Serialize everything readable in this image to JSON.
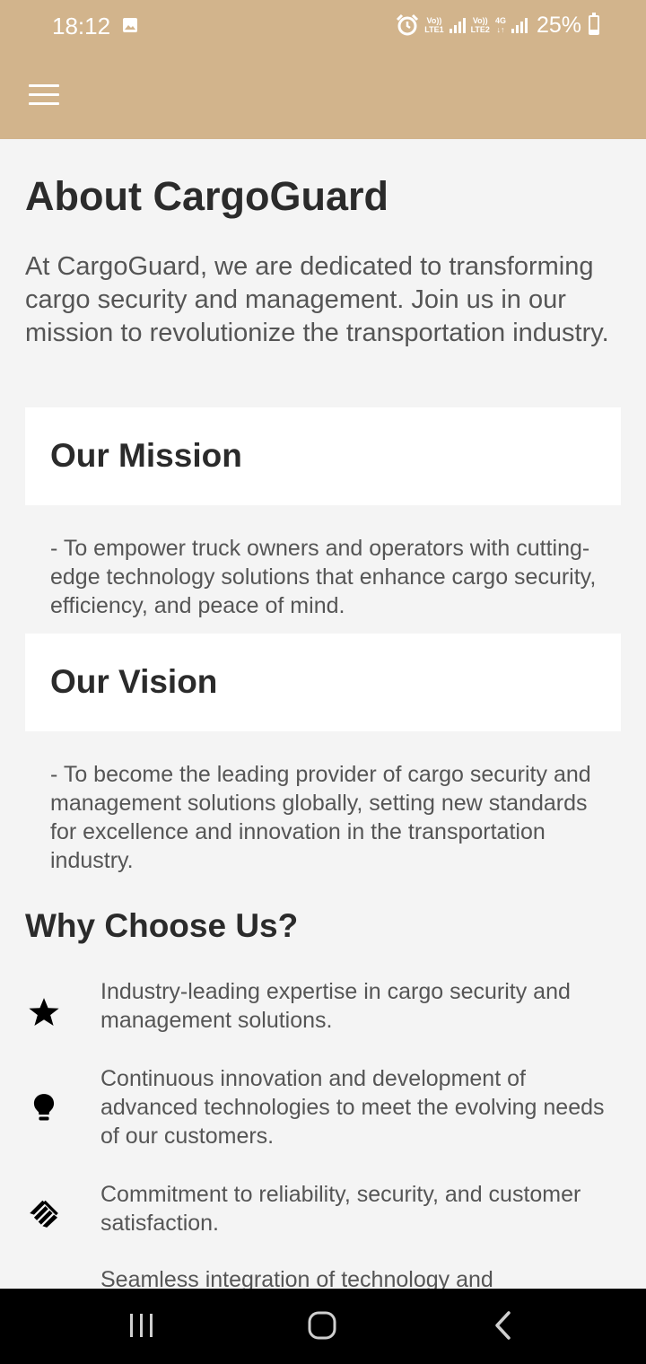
{
  "status_bar": {
    "time": "18:12",
    "sim1": {
      "top": "Vo))",
      "bottom": "LTE1"
    },
    "sim2": {
      "top": "Vo))",
      "bottom": "LTE2"
    },
    "network_type": "4G",
    "battery_percent": "25%",
    "icons": [
      "gallery-icon",
      "alarm-icon",
      "signal-icon",
      "battery-icon"
    ]
  },
  "app_bar": {
    "background": "#d2b48c",
    "menu_icon": "hamburger-menu-icon"
  },
  "about": {
    "title": "About CargoGuard",
    "intro": "At CargoGuard, we are dedicated to transforming cargo security and management. Join us in our mission to revolutionize the transportation industry."
  },
  "mission": {
    "title": "Our Mission",
    "text": "- To empower truck owners and operators with cutting-edge technology solutions that enhance cargo security, efficiency, and peace of mind."
  },
  "vision": {
    "title": "Our Vision",
    "text": "- To become the leading provider of cargo security and management solutions globally, setting new standards for excellence and innovation in the transportation industry."
  },
  "why_choose_us": {
    "title": "Why Choose Us?",
    "items": [
      {
        "icon": "star-icon",
        "text": "Industry-leading expertise in cargo security and management solutions."
      },
      {
        "icon": "lightbulb-icon",
        "text": "Continuous innovation and development of advanced technologies to meet the evolving needs of our customers."
      },
      {
        "icon": "handshake-icon",
        "text": "Commitment to reliability, security, and customer satisfaction."
      },
      {
        "icon": "integration-icon",
        "text": "Seamless integration of technology and"
      }
    ]
  },
  "nav_bar": {
    "buttons": [
      "recent-apps-icon",
      "home-icon",
      "back-icon"
    ]
  }
}
